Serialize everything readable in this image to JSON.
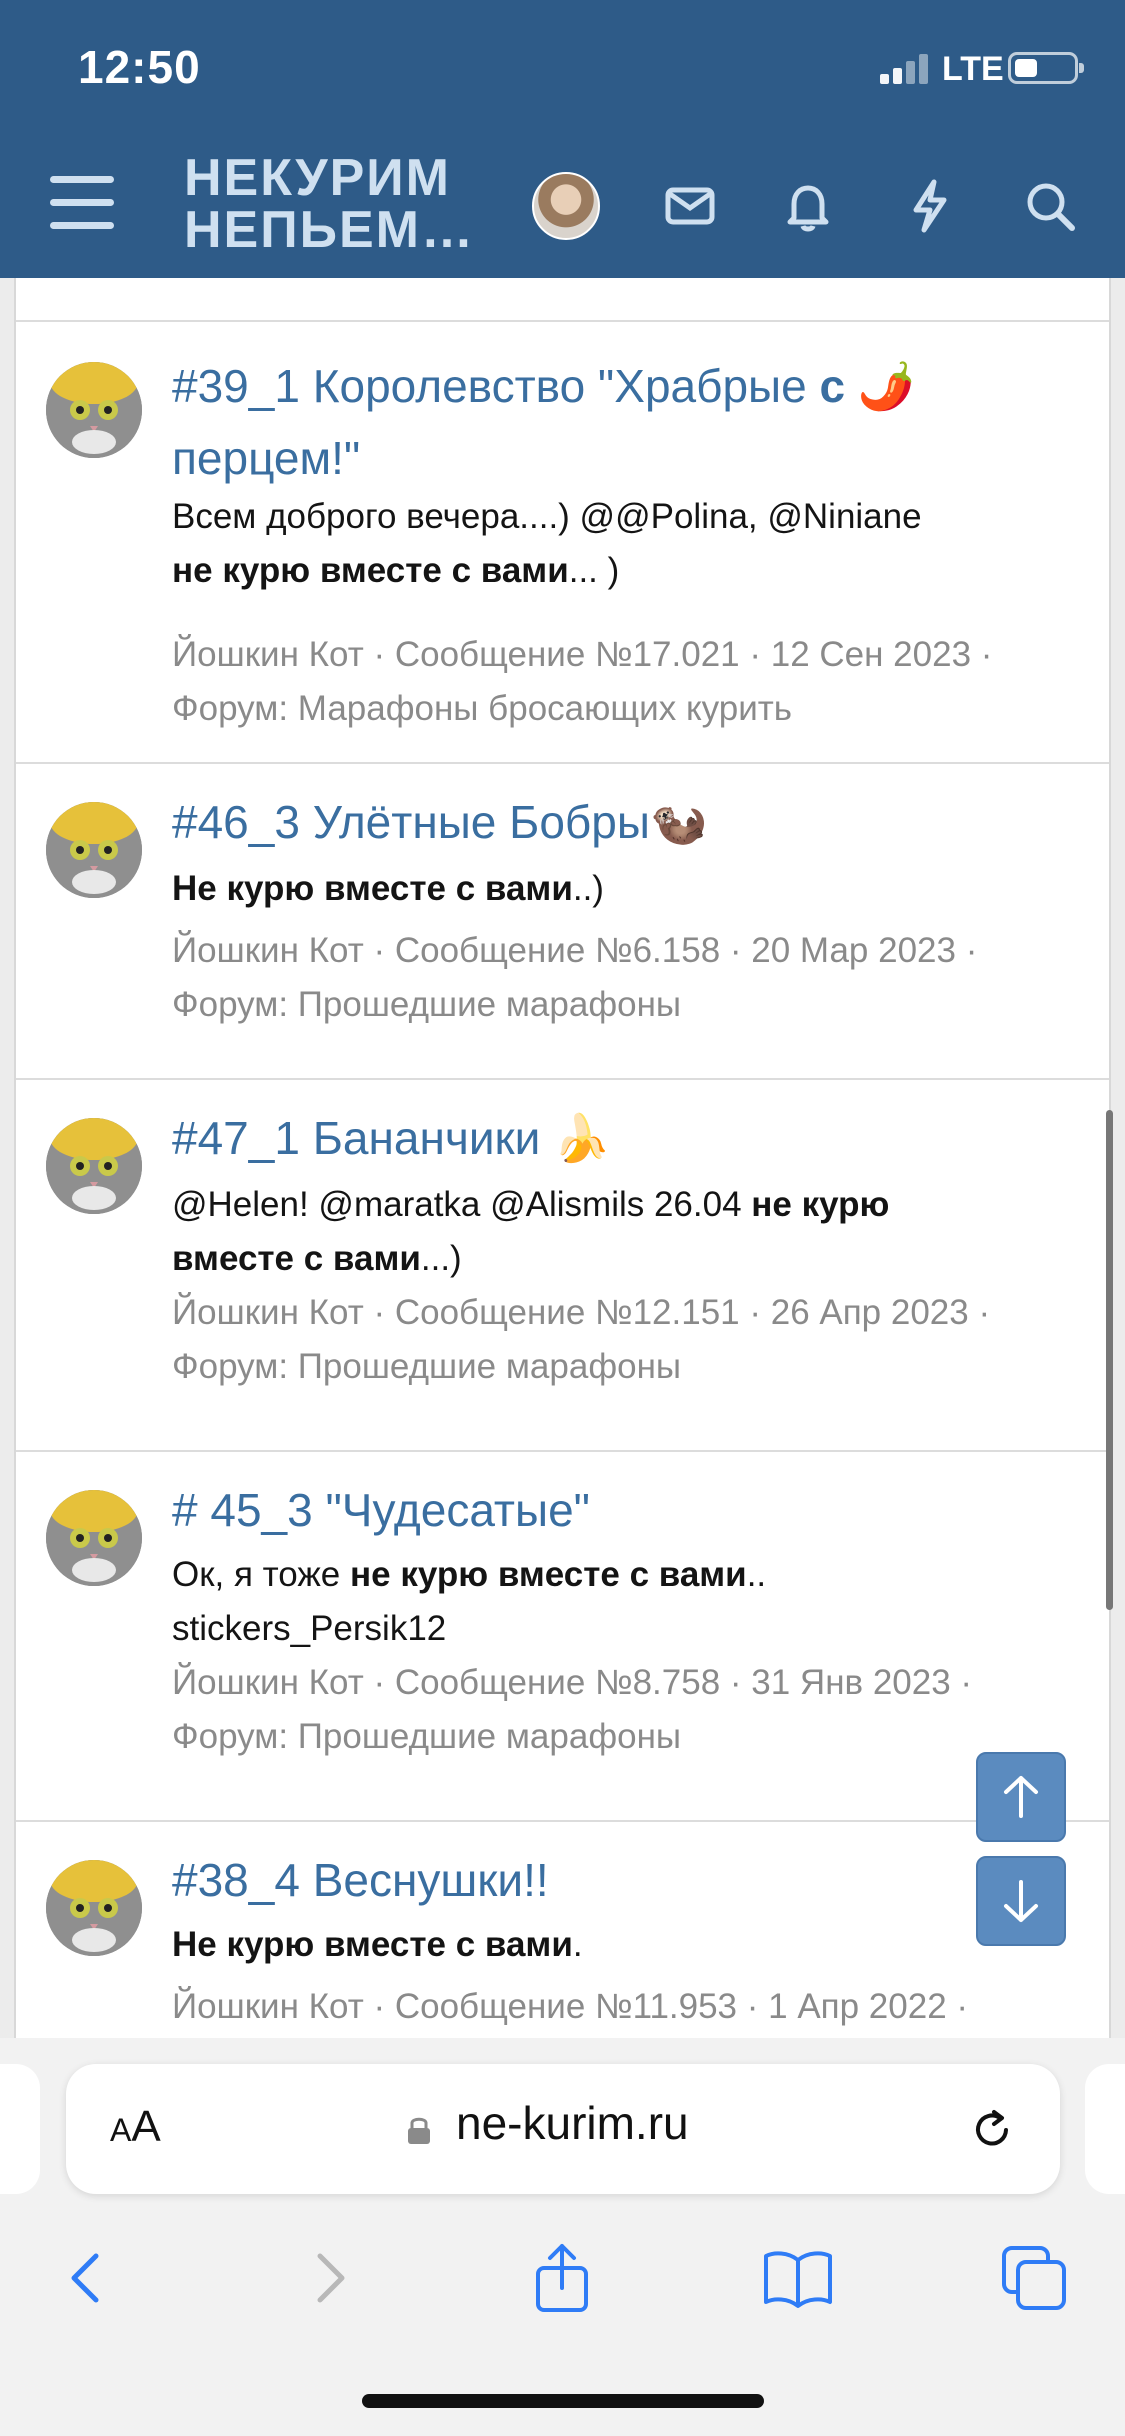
{
  "status": {
    "time": "12:50",
    "network": "LTE"
  },
  "header": {
    "logo_line1": "НЕКУРИМ",
    "logo_line2": "НЕПЬЕМ…"
  },
  "results": [
    {
      "title": "#39_1 Королевство \"Храбрые ",
      "title_bold": "с",
      "title_emoji": "🌶️",
      "title_end": "перцем!\"",
      "snippet_plain": "Всем доброго вечера....) @@Polina, @Niniane ",
      "snippet_bold": "не курю вместе с вами",
      "snippet_tail": "... )",
      "meta": "Йошкин Кот · Сообщение №17.021 · 12 Сен 2023 · Форум: Марафоны бросающих курить"
    },
    {
      "title": "#46_3 Улётные Бобры",
      "title_emoji": "🦦",
      "snippet_plain": "",
      "snippet_bold": "Не курю вместе с вами",
      "snippet_tail": "..)",
      "meta": "Йошкин Кот · Сообщение №6.158 · 20 Мар 2023 · Форум: Прошедшие марафоны"
    },
    {
      "title": "#47_1 Бананчики ",
      "title_emoji": "🍌",
      "snippet_plain": "@Helen! @maratka @Alismils 26.04 ",
      "snippet_bold": "не курю вместе с вами",
      "snippet_tail": "...)",
      "meta": "Йошкин Кот · Сообщение №12.151 · 26 Апр 2023 · Форум: Прошедшие марафоны"
    },
    {
      "title": "# 45_3 \"Чудесатые\"",
      "snippet_plain": "Ок, я тоже ",
      "snippet_bold": "не курю вместе с вами",
      "snippet_tail": ".. stickers_Persik12",
      "meta": "Йошкин Кот · Сообщение №8.758 · 31 Янв 2023 · Форум: Прошедшие марафоны"
    },
    {
      "title": "#38_4 Веснушки!!",
      "snippet_plain": "",
      "snippet_bold": "Не курю вместе с вами",
      "snippet_tail": ".",
      "meta": "Йошкин Кот · Сообщение №11.953 · 1 Апр 2022 ·"
    }
  ],
  "browser": {
    "aa_label_small": "A",
    "aa_label_big": "A",
    "url": "ne-kurim.ru"
  },
  "icons": {
    "menu": "hamburger-icon",
    "inbox": "envelope-icon",
    "alerts": "bell-icon",
    "whats_new": "bolt-icon",
    "search": "search-icon",
    "back": "chevron-left-icon",
    "forward": "chevron-right-icon",
    "share": "share-icon",
    "bookmarks": "book-icon",
    "tabs": "tabs-icon"
  },
  "colors": {
    "header_bg": "#2e5b88",
    "link": "#3a6ea0",
    "meta": "#8a8a8a",
    "jump_btn": "#5b8bbf"
  }
}
